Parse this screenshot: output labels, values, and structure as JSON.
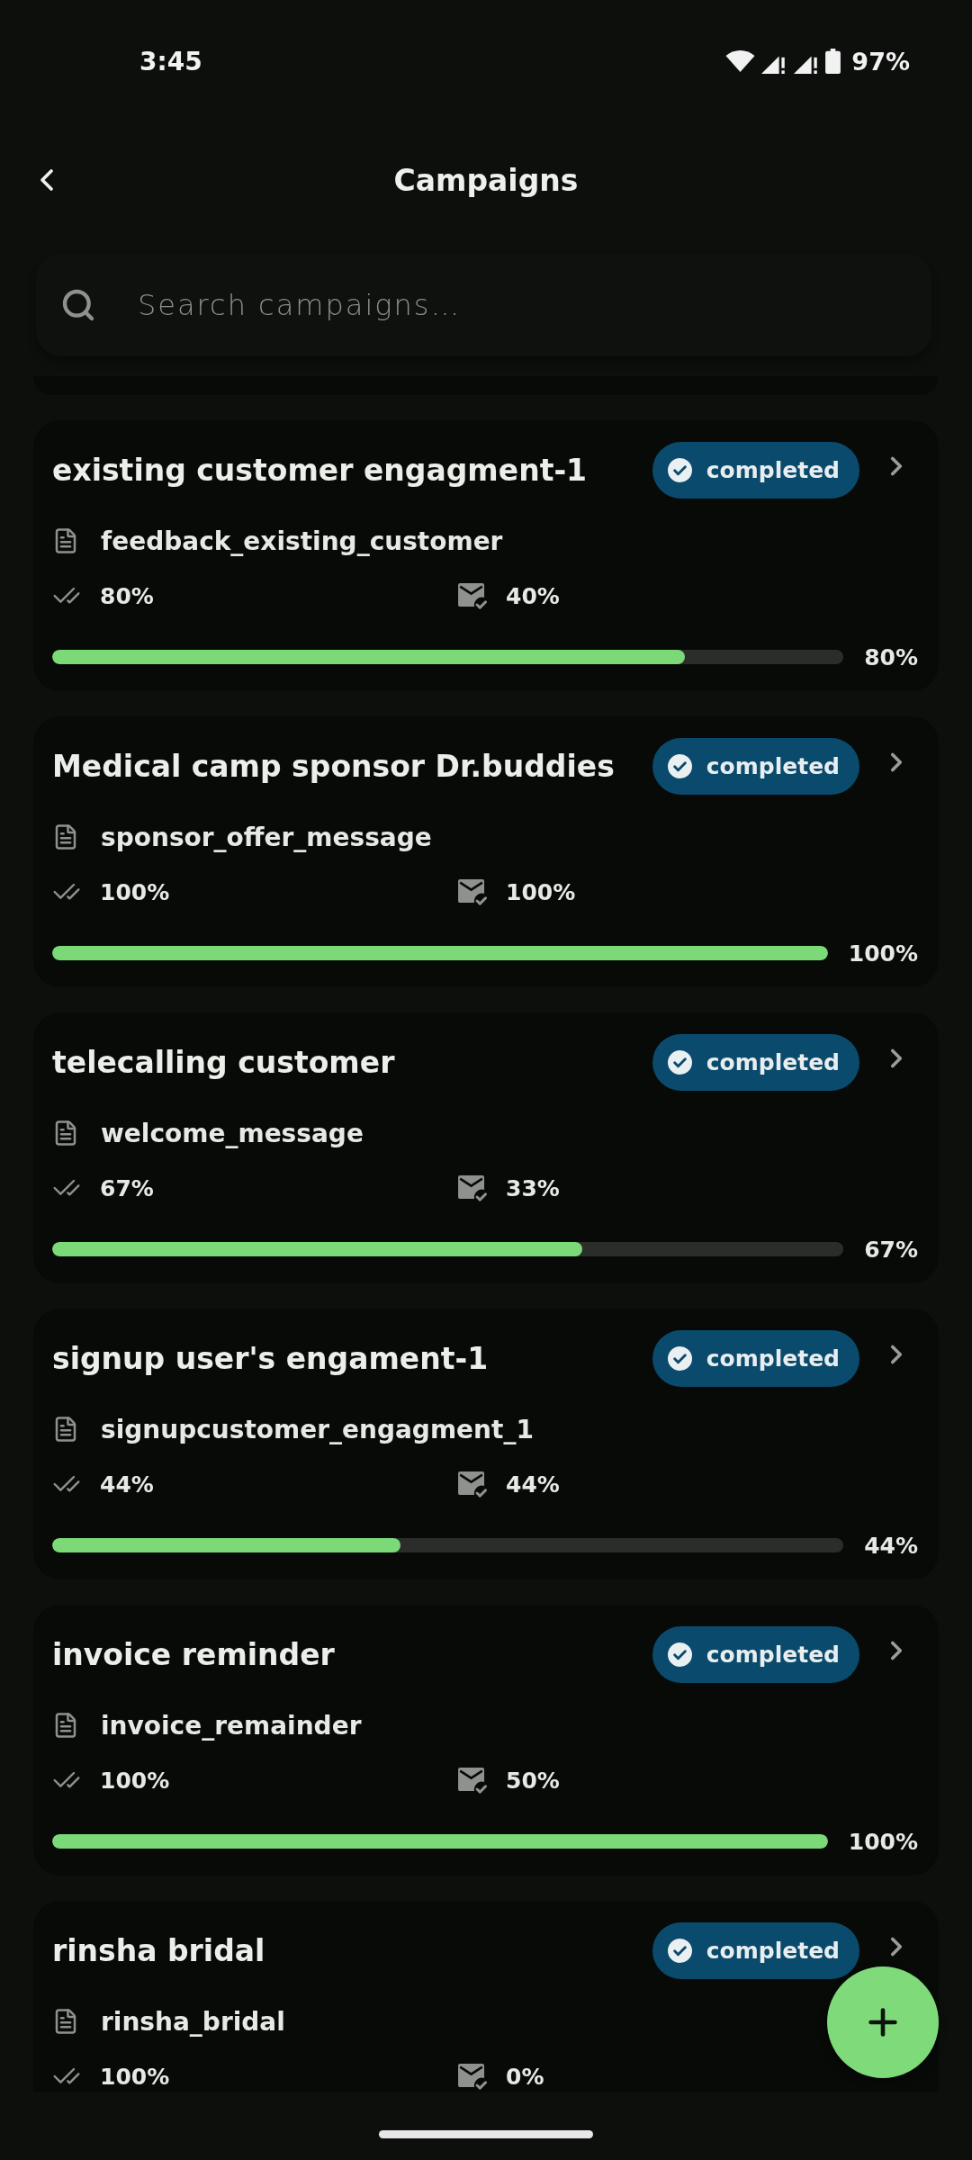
{
  "status_bar": {
    "time": "3:45",
    "battery": "97%"
  },
  "header": {
    "title": "Campaigns"
  },
  "search": {
    "placeholder": "Search campaigns…"
  },
  "campaigns": [
    {
      "title": "existing customer engagment-1",
      "status": "completed",
      "template": "feedback_existing_customer",
      "tick_value": "80%",
      "mail_value": "40%",
      "progress": {
        "level": 0.8,
        "label": "80%"
      }
    },
    {
      "title": "Medical camp sponsor Dr.buddies",
      "status": "completed",
      "template": "sponsor_offer_message",
      "tick_value": "100%",
      "mail_value": "100%",
      "progress": {
        "level": 1,
        "label": "100%"
      }
    },
    {
      "title": "telecalling customer",
      "status": "completed",
      "template": "welcome_message",
      "tick_value": "67%",
      "mail_value": "33%",
      "progress": {
        "level": 0.67,
        "label": "67%"
      }
    },
    {
      "title": "signup user's engament-1",
      "status": "completed",
      "template": "signupcustomer_engagment_1",
      "tick_value": "44%",
      "mail_value": "44%",
      "progress": {
        "level": 0.44,
        "label": "44%"
      }
    },
    {
      "title": "invoice reminder",
      "status": "completed",
      "template": "invoice_remainder",
      "tick_value": "100%",
      "mail_value": "50%",
      "progress": {
        "level": 1,
        "label": "100%"
      }
    },
    {
      "title": "rinsha bridal",
      "status": "completed",
      "template": "rinsha_bridal",
      "tick_value": "100%",
      "mail_value": "0%"
    }
  ]
}
